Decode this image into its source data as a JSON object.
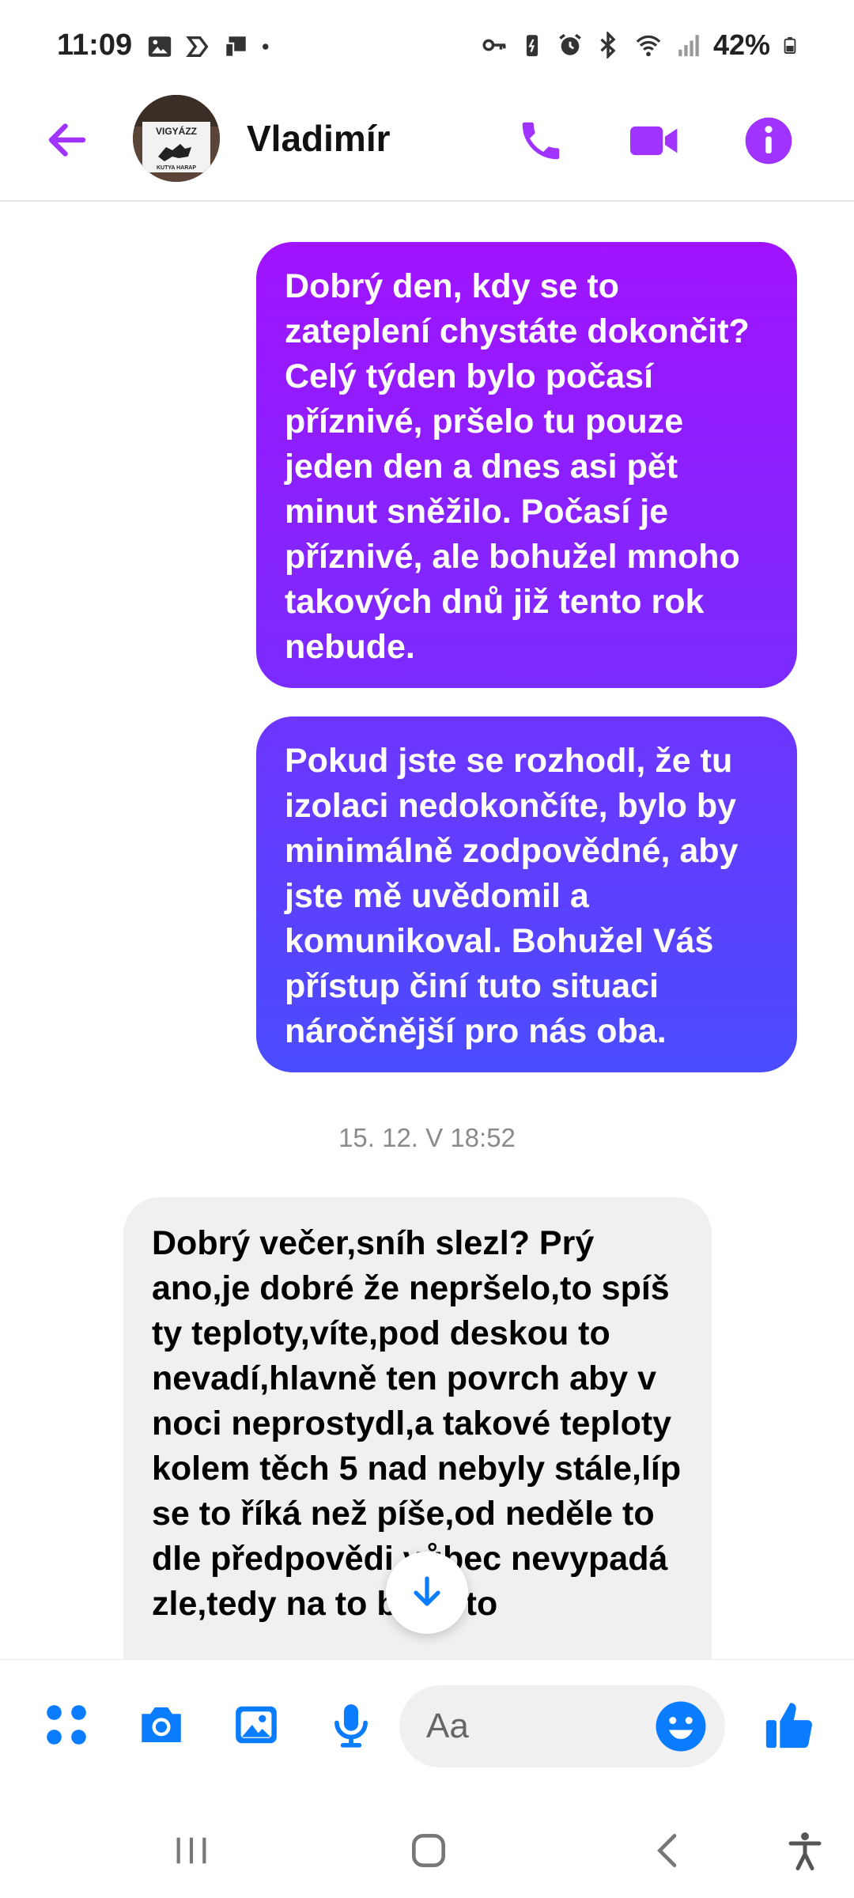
{
  "status_bar": {
    "time": "11:09",
    "battery": "42%"
  },
  "header": {
    "contact_name": "Vladimír",
    "avatar_text_top": "VIGYÁZZ",
    "avatar_text_bottom": "KUTYA HARAP"
  },
  "messages": [
    {
      "direction": "outgoing",
      "text": "Dobrý den, kdy se to zateplení chystáte dokončit? Celý týden bylo počasí příznivé, pršelo tu pouze jeden den a dnes asi pět minut sněžilo. Počasí je příznivé, ale bohužel mnoho takových dnů již tento rok nebude."
    },
    {
      "direction": "outgoing",
      "text": "Pokud jste se rozhodl, že  tu izolaci nedokončíte, bylo by minimálně zodpovědné, aby jste mě uvědomil a komunikoval. Bohužel  Váš přístup činí tuto situaci náročnější pro nás oba."
    },
    {
      "direction": "incoming",
      "text": "Dobrý večer,sníh slezl? Prý ano,je dobré že nepršelo,to spíš ty teploty,víte,pod deskou to nevadí,hlavně ten povrch aby v noci neprostydl,a takové teploty kolem těch 5 nad nebyly stále,líp se to říká než píše,od neděle to dle předpovědi vůbec nevypadá zle,tedy na to bych to"
    }
  ],
  "timestamp": "15. 12. V 18:52",
  "composer": {
    "placeholder": "Aa"
  },
  "colors": {
    "accent": "#a033ff",
    "messenger_blue": "#0a7cff",
    "outgoing_top": "#a013ff",
    "outgoing_bottom": "#4a4cff",
    "incoming_bg": "#f0f0f0"
  },
  "icons": {
    "back": "back-arrow-icon",
    "call": "phone-icon",
    "video": "video-camera-icon",
    "info": "info-icon",
    "menu": "four-dots-icon",
    "camera": "camera-icon",
    "gallery": "image-icon",
    "mic": "microphone-icon",
    "emoji": "emoji-icon",
    "like": "thumbs-up-icon",
    "scroll_down": "arrow-down-icon"
  }
}
